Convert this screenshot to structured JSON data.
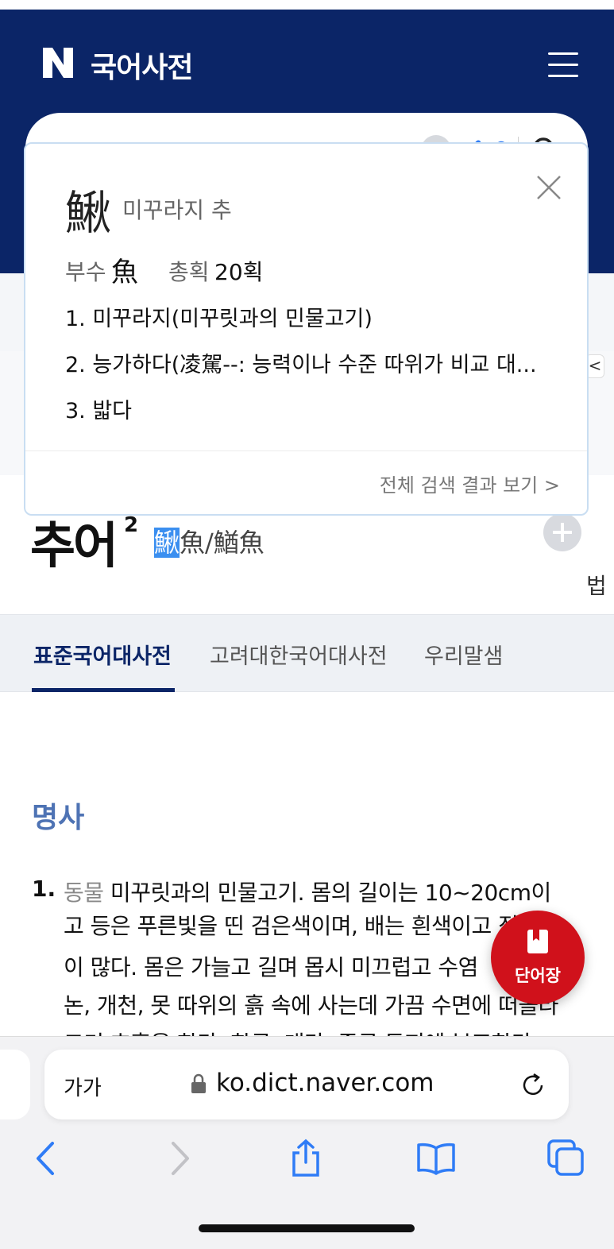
{
  "header": {
    "logo_letter": "N",
    "title": "국어사전"
  },
  "search": {
    "query": "추어"
  },
  "side_clip": {
    "text": "법",
    "arrow": "<"
  },
  "popup": {
    "hanja": "鰍",
    "meaning": "미꾸라지 추",
    "radical_label": "부수",
    "radical": "魚",
    "strokes_label": "총획",
    "strokes": "20획",
    "definitions": [
      "1. 미꾸라지(미꾸릿과의 민물고기)",
      "2. 능가하다(凌駕--: 능력이나 수준 따위가 비교 대...",
      "3. 밟다"
    ],
    "full_results": "전체 검색 결과 보기 >"
  },
  "entry": {
    "headword": "추어",
    "superscript": "2",
    "hanja_highlight": "鰍",
    "hanja_rest": "魚/鰌魚"
  },
  "tabs": [
    {
      "label": "표준국어대사전",
      "active": true
    },
    {
      "label": "고려대한국어대사전",
      "active": false
    },
    {
      "label": "우리말샘",
      "active": false
    }
  ],
  "definition": {
    "part_of_speech": "명사",
    "number": "1.",
    "category": "동물",
    "lines": [
      " 미꾸릿과의 민물고기. 몸의 길이는 10~20cm이",
      "고 등은 푸른빛을 띤 검은색이며, 배는 흰색이고 점",
      "이 많다. 몸은 가늘고 길며 몹시 미끄럽고 수염",
      "논, 개천, 못 따위의 흙 속에 사는데 가끔 수면에 떠올라",
      "고기 호흡을 한다. 한국, 대만, 중국 등지에 분포한다."
    ]
  },
  "fab": {
    "label": "단어장"
  },
  "browser": {
    "text_size": "가가",
    "url": "ko.dict.naver.com"
  },
  "colors": {
    "brand_navy": "#0b2567",
    "fab_red": "#d0111b",
    "pos_blue": "#4e73b4",
    "ios_blue": "#2f7cf6"
  }
}
